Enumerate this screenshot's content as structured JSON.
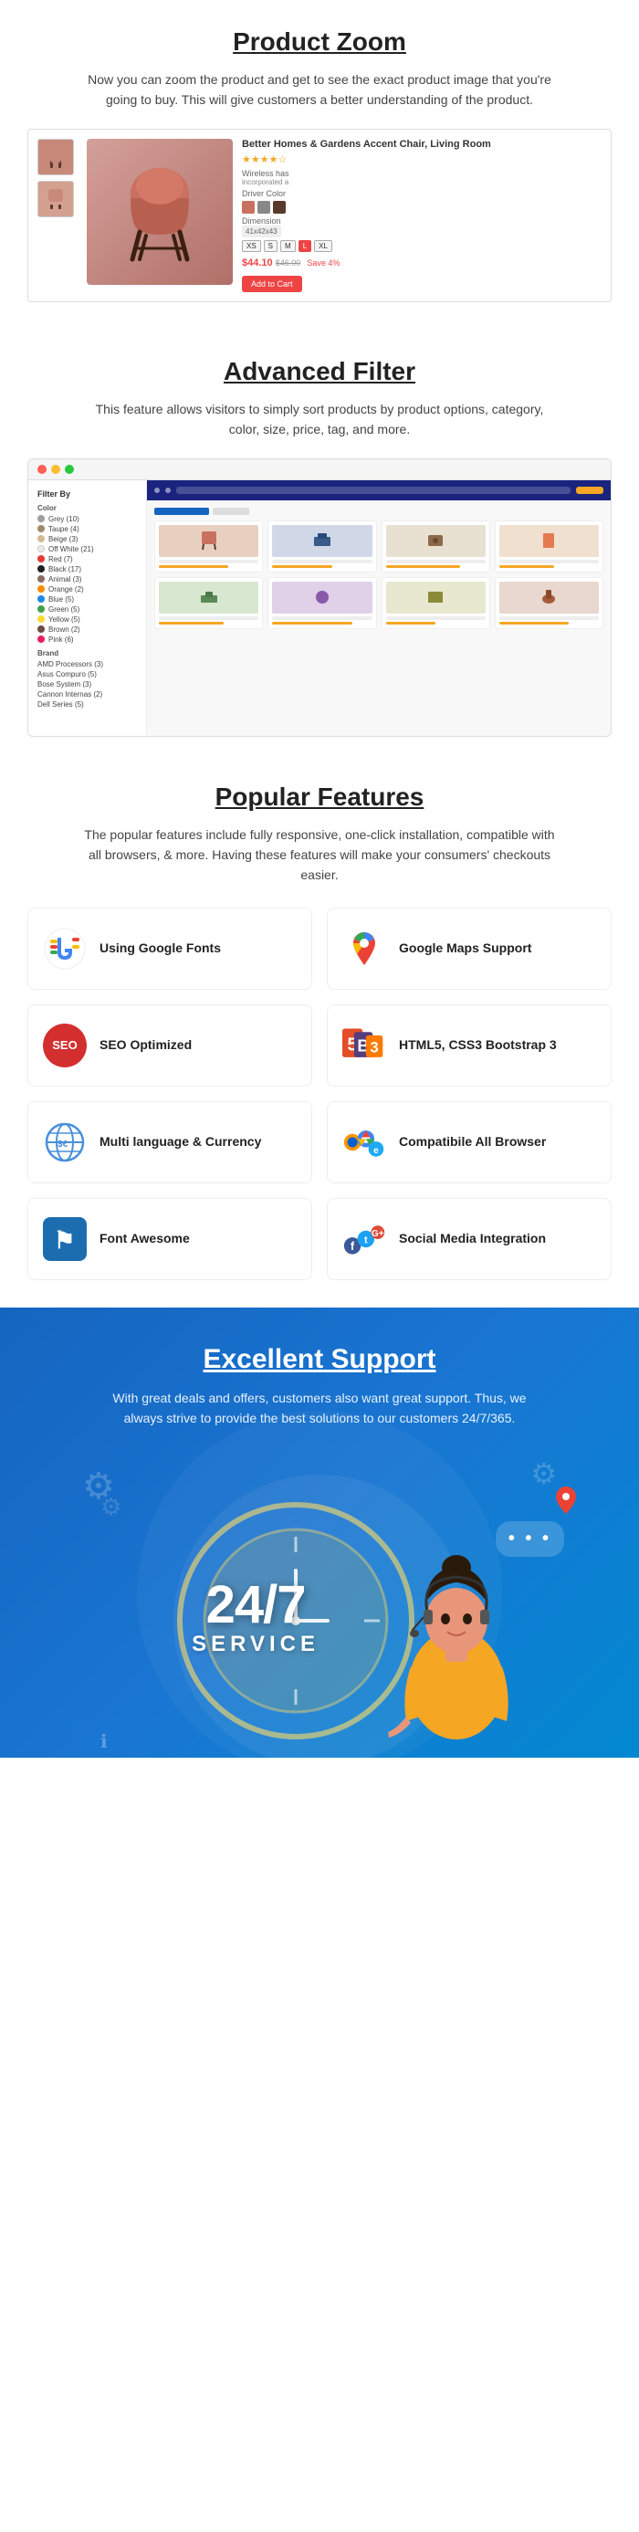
{
  "productZoom": {
    "title": "Product Zoom",
    "description": "Now you can zoom the product and get to see the exact product image that you're going to buy. This will give customers a better understanding of the product.",
    "product": {
      "name": "Better Homes & Gardens Accent Chair, Living Room",
      "price_current": "$44.10",
      "price_old": "$46.00",
      "price_save": "Save 4%"
    }
  },
  "advancedFilter": {
    "title": "Advanced Filter",
    "description": "This feature allows visitors to simply sort products by product options, category, color, size, price, tag, and more.",
    "filterBy": "Filter By",
    "colorLabel": "Color",
    "brandLabel": "Brand",
    "colors": [
      {
        "name": "Grey (10)",
        "color": "#9e9e9e"
      },
      {
        "name": "Taupe (4)",
        "color": "#a0896f"
      },
      {
        "name": "Beige (3)",
        "color": "#d4b896"
      },
      {
        "name": "Off White (21)",
        "color": "#f0ebe0"
      },
      {
        "name": "Red (7)",
        "color": "#e53935"
      },
      {
        "name": "Black (17)",
        "color": "#212121"
      },
      {
        "name": "Animal (3)",
        "color": "#8d6e63"
      },
      {
        "name": "Orange (2)",
        "color": "#fb8c00"
      },
      {
        "name": "Blue (5)",
        "color": "#1e88e5"
      },
      {
        "name": "Green (5)",
        "color": "#43a047"
      },
      {
        "name": "Yellow (5)",
        "color": "#fdd835"
      },
      {
        "name": "Brown (2)",
        "color": "#6d4c41"
      },
      {
        "name": "Pink (6)",
        "color": "#e91e63"
      }
    ],
    "brands": [
      "AMD Processors (3)",
      "Asus Compuro (5)",
      "Bose System (3)",
      "Cannon Internas (2)",
      "Dell Series (5)"
    ]
  },
  "popularFeatures": {
    "title": "Popular Features",
    "description": "The popular features include  fully responsive, one-click installation, compatible with all browsers, & more. Having these features will make your consumers' checkouts easier.",
    "features": [
      {
        "id": "google-fonts",
        "label": "Using Google Fonts",
        "iconType": "google-fonts"
      },
      {
        "id": "google-maps",
        "label": "Google Maps Support",
        "iconType": "google-maps"
      },
      {
        "id": "seo",
        "label": "SEO Optimized",
        "iconType": "seo"
      },
      {
        "id": "html5",
        "label": "HTML5, CSS3 Bootstrap 3",
        "iconType": "html5"
      },
      {
        "id": "multilang",
        "label": "Multi language & Currency",
        "iconType": "multilang"
      },
      {
        "id": "compat",
        "label": "Compatibile All Browser",
        "iconType": "compat"
      },
      {
        "id": "fontawesome",
        "label": "Font Awesome",
        "iconType": "fontawesome"
      },
      {
        "id": "social",
        "label": "Social Media Integration",
        "iconType": "social"
      }
    ]
  },
  "excellentSupport": {
    "title": "Excellent Support",
    "description": "With great deals and offers, customers also want great support. Thus, we always strive to provide the best solutions to our customers 24/7/365.",
    "service247": "24/7",
    "serviceLabel": "SERVICE"
  }
}
